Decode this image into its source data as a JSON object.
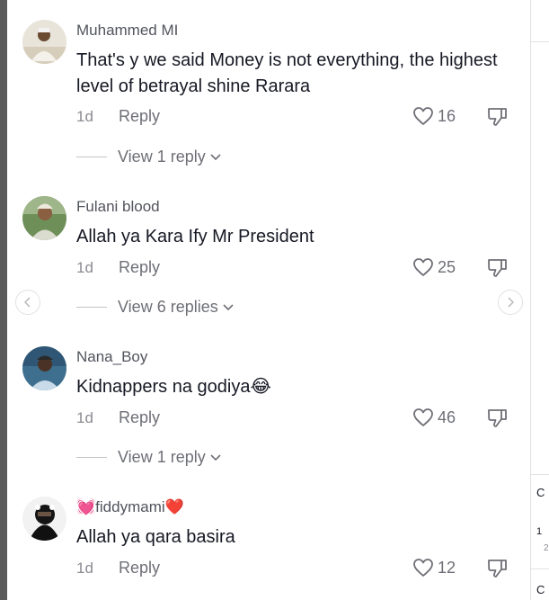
{
  "comments": [
    {
      "username": "Muhammed MI",
      "text": "That's y we said Money is not everything, the highest level of betrayal shine Rarara",
      "time": "1d",
      "reply_label": "Reply",
      "likes": "16",
      "view_replies": "View 1 reply"
    },
    {
      "username": "Fulani blood",
      "text": "Allah ya Kara Ify Mr President",
      "time": "1d",
      "reply_label": "Reply",
      "likes": "25",
      "view_replies": "View 6 replies"
    },
    {
      "username": "Nana_Boy",
      "text": "Kidnappers na godiya",
      "emoji": "😂",
      "time": "1d",
      "reply_label": "Reply",
      "likes": "46",
      "view_replies": "View 1 reply"
    },
    {
      "username": "fiddymami",
      "username_prefix_emoji": "💓",
      "username_suffix_emoji": "❤️",
      "text": "Allah ya qara basira",
      "time": "1d",
      "reply_label": "Reply",
      "likes": "12"
    }
  ],
  "right_panel": {
    "glyph_c1": "C",
    "num": "1",
    "small": "2",
    "glyph_c2": "C"
  },
  "icons": {
    "like": "heart-outline-icon",
    "dislike": "thumbs-down-icon",
    "chevron": "chevron-down-icon",
    "prev": "chevron-left-icon",
    "next": "chevron-right-icon"
  },
  "colors": {
    "primary_text": "#161823",
    "secondary_text": "#6e6f76",
    "muted_text": "#8a8b91"
  }
}
